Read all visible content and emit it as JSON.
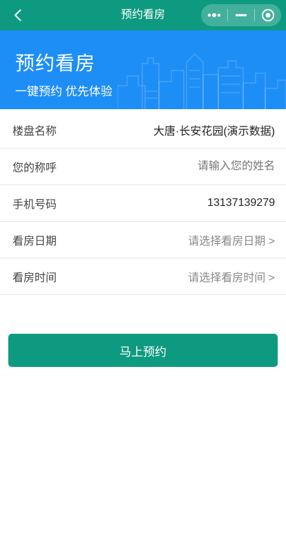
{
  "navbar": {
    "title": "预约看房",
    "back_icon": "chevron-left-icon",
    "capsule": {
      "more_icon": "more-dots-icon",
      "minimize_icon": "minimize-icon",
      "close_icon": "target-close-icon"
    },
    "background": "#0e9a80"
  },
  "banner": {
    "title": "预约看房",
    "subtitle": "一键预约 优先体验",
    "background": "#1e8ef7",
    "decoration_icon": "city-skyline-icon"
  },
  "form": {
    "rows": [
      {
        "label": "楼盘名称",
        "value": "大唐·长安花园(演示数据)"
      },
      {
        "label": "您的称呼",
        "placeholder": "请输入您的姓名"
      },
      {
        "label": "手机号码",
        "value": "13137139279"
      },
      {
        "label": "看房日期",
        "placeholder": "请选择看房日期 >"
      },
      {
        "label": "看房时间",
        "placeholder": "请选择看房时间 >"
      }
    ]
  },
  "submit": {
    "label": "马上预约",
    "color": "#0e9a80"
  }
}
